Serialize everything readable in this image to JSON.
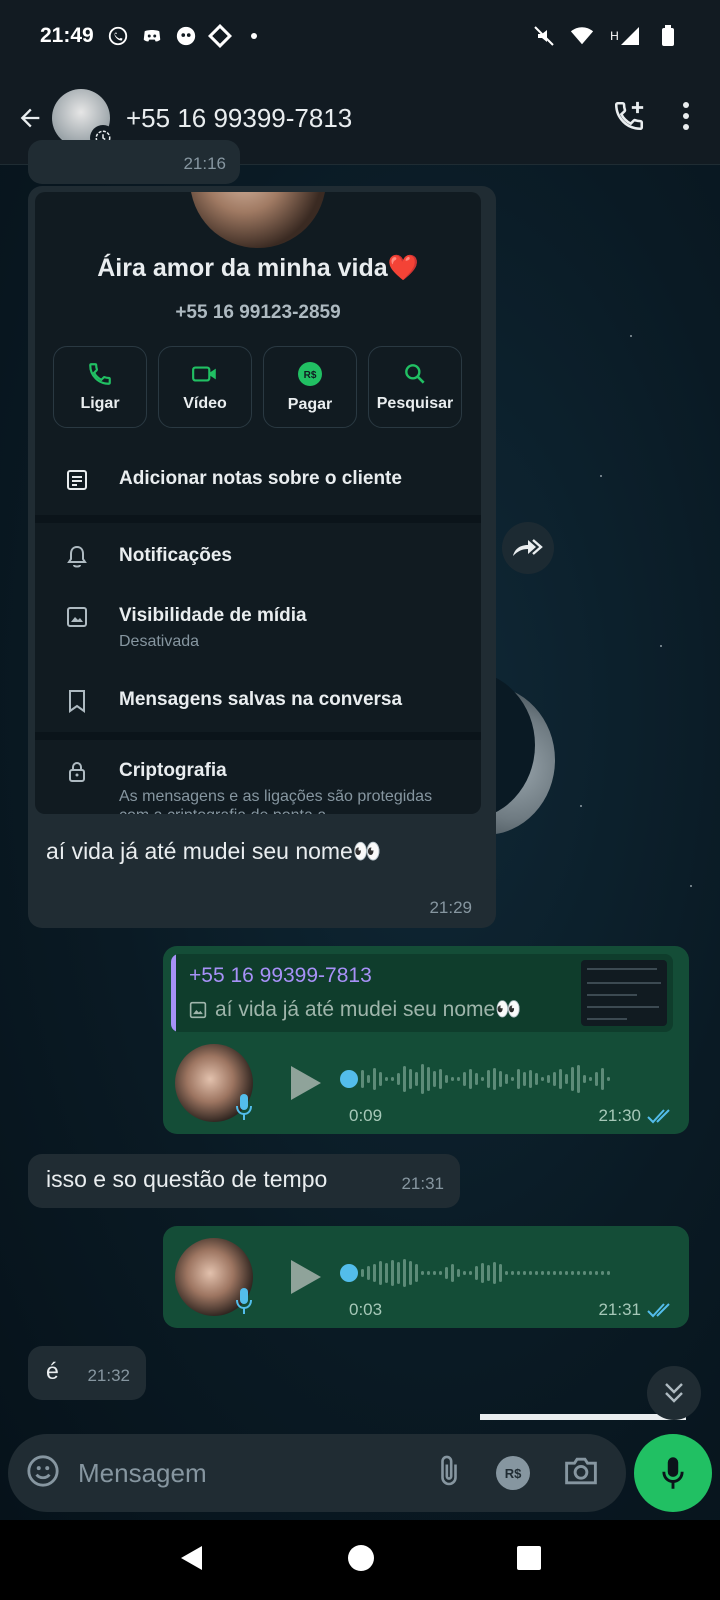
{
  "status_bar": {
    "time": "21:49",
    "network": "H"
  },
  "header": {
    "contact": "+55 16 99399-7813"
  },
  "shared_screenshot": {
    "name": "Áira amor da minha vida❤️",
    "number": "+55 16 99123-2859",
    "actions": [
      {
        "label": "Ligar",
        "icon": "phone-icon"
      },
      {
        "label": "Vídeo",
        "icon": "video-icon"
      },
      {
        "label": "Pagar",
        "icon": "pay-icon",
        "badge": "R$"
      },
      {
        "label": "Pesquisar",
        "icon": "search-icon"
      }
    ],
    "notes_label": "Adicionar notas sobre o cliente",
    "notifications_label": "Notificações",
    "media_visibility": {
      "title": "Visibilidade de mídia",
      "subtitle": "Desativada"
    },
    "saved_messages_label": "Mensagens salvas na conversa",
    "encryption": {
      "title": "Criptografia",
      "subtitle": "As mensagens e as ligações são protegidas com a criptografia de ponta a"
    }
  },
  "messages": {
    "m1_partial_time": "21:16",
    "m1_caption": "aí vida já até mudei seu nome👀",
    "m1_time": "21:29",
    "m2_quote_author": "+55 16 99399-7813",
    "m2_quote_text": "aí vida já até mudei seu nome👀",
    "m2_duration": "0:09",
    "m2_time": "21:30",
    "m3_text": "isso e so questão de tempo",
    "m3_time": "21:31",
    "m4_duration": "0:03",
    "m4_time": "21:31",
    "m5_text": "é",
    "m5_time": "21:32"
  },
  "composer": {
    "placeholder": "Mensagem",
    "pay_badge": "R$"
  },
  "colors": {
    "accent": "#21c063",
    "outgoing": "#144d37",
    "incoming": "#202c33",
    "read_ticks": "#53bdeb",
    "quote_author": "#a791f7"
  }
}
